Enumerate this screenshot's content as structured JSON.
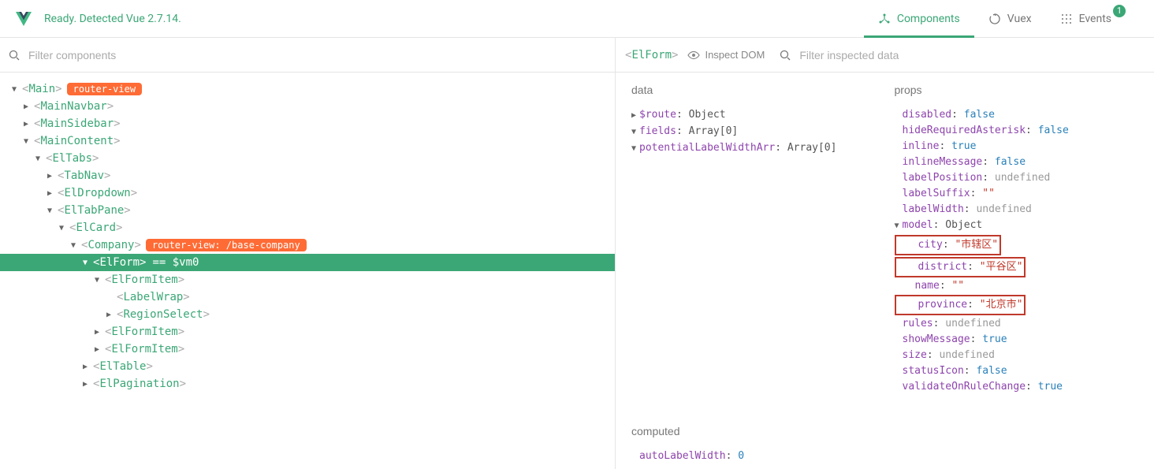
{
  "header": {
    "status": "Ready. Detected Vue 2.7.14.",
    "tabs": [
      {
        "label": "Components",
        "active": true
      },
      {
        "label": "Vuex",
        "active": false
      },
      {
        "label": "Events",
        "active": false,
        "badge": "1"
      }
    ]
  },
  "left": {
    "filter_placeholder": "Filter components",
    "tree": [
      {
        "depth": 0,
        "arrow": "down",
        "name": "Main",
        "badge": "router-view"
      },
      {
        "depth": 1,
        "arrow": "right",
        "name": "MainNavbar"
      },
      {
        "depth": 1,
        "arrow": "right",
        "name": "MainSidebar"
      },
      {
        "depth": 1,
        "arrow": "down",
        "name": "MainContent"
      },
      {
        "depth": 2,
        "arrow": "down",
        "name": "ElTabs"
      },
      {
        "depth": 3,
        "arrow": "right",
        "name": "TabNav"
      },
      {
        "depth": 3,
        "arrow": "right",
        "name": "ElDropdown"
      },
      {
        "depth": 3,
        "arrow": "down",
        "name": "ElTabPane"
      },
      {
        "depth": 4,
        "arrow": "down",
        "name": "ElCard"
      },
      {
        "depth": 5,
        "arrow": "down",
        "name": "Company",
        "route_badge": "router-view: /base-company"
      },
      {
        "depth": 6,
        "arrow": "down",
        "name": "ElForm",
        "selected": true,
        "suffix": " == $vm0"
      },
      {
        "depth": 7,
        "arrow": "down",
        "name": "ElFormItem"
      },
      {
        "depth": 8,
        "arrow": "none",
        "name": "LabelWrap"
      },
      {
        "depth": 8,
        "arrow": "right",
        "name": "RegionSelect"
      },
      {
        "depth": 7,
        "arrow": "right",
        "name": "ElFormItem"
      },
      {
        "depth": 7,
        "arrow": "right",
        "name": "ElFormItem"
      },
      {
        "depth": 6,
        "arrow": "right",
        "name": "ElTable"
      },
      {
        "depth": 6,
        "arrow": "right",
        "name": "ElPagination"
      }
    ]
  },
  "right": {
    "inspected_component": "ElForm",
    "inspect_dom_label": "Inspect DOM",
    "filter_placeholder": "Filter inspected data",
    "sections": {
      "data": {
        "title": "data",
        "rows": [
          {
            "arrow": "right",
            "key": "$route",
            "val": "Object",
            "type": "plain"
          },
          {
            "arrow": "down",
            "key": "fields",
            "val": "Array[0]",
            "type": "plain"
          },
          {
            "arrow": "down",
            "key": "potentialLabelWidthArr",
            "val": "Array[0]",
            "type": "plain"
          }
        ]
      },
      "props": {
        "title": "props",
        "rows": [
          {
            "indent": 0,
            "key": "disabled",
            "val": "false",
            "type": "bool"
          },
          {
            "indent": 0,
            "key": "hideRequiredAsterisk",
            "val": "false",
            "type": "bool"
          },
          {
            "indent": 0,
            "key": "inline",
            "val": "true",
            "type": "bool"
          },
          {
            "indent": 0,
            "key": "inlineMessage",
            "val": "false",
            "type": "bool"
          },
          {
            "indent": 0,
            "key": "labelPosition",
            "val": "undefined",
            "type": "undef"
          },
          {
            "indent": 0,
            "key": "labelSuffix",
            "val": "\"\"",
            "type": "str"
          },
          {
            "indent": 0,
            "key": "labelWidth",
            "val": "undefined",
            "type": "undef"
          },
          {
            "indent": 0,
            "arrow": "down",
            "key": "model",
            "val": "Object",
            "type": "plain"
          },
          {
            "indent": 1,
            "key": "city",
            "val": "\"市辖区\"",
            "type": "str",
            "hl": true
          },
          {
            "indent": 1,
            "key": "district",
            "val": "\"平谷区\"",
            "type": "str",
            "hl": true
          },
          {
            "indent": 1,
            "key": "name",
            "val": "\"\"",
            "type": "str"
          },
          {
            "indent": 1,
            "key": "province",
            "val": "\"北京市\"",
            "type": "str",
            "hl": true
          },
          {
            "indent": 0,
            "key": "rules",
            "val": "undefined",
            "type": "undef"
          },
          {
            "indent": 0,
            "key": "showMessage",
            "val": "true",
            "type": "bool"
          },
          {
            "indent": 0,
            "key": "size",
            "val": "undefined",
            "type": "undef"
          },
          {
            "indent": 0,
            "key": "statusIcon",
            "val": "false",
            "type": "bool"
          },
          {
            "indent": 0,
            "key": "validateOnRuleChange",
            "val": "true",
            "type": "bool"
          }
        ]
      },
      "computed": {
        "title": "computed",
        "rows": [
          {
            "key": "autoLabelWidth",
            "val": "0",
            "type": "num"
          }
        ]
      }
    }
  }
}
